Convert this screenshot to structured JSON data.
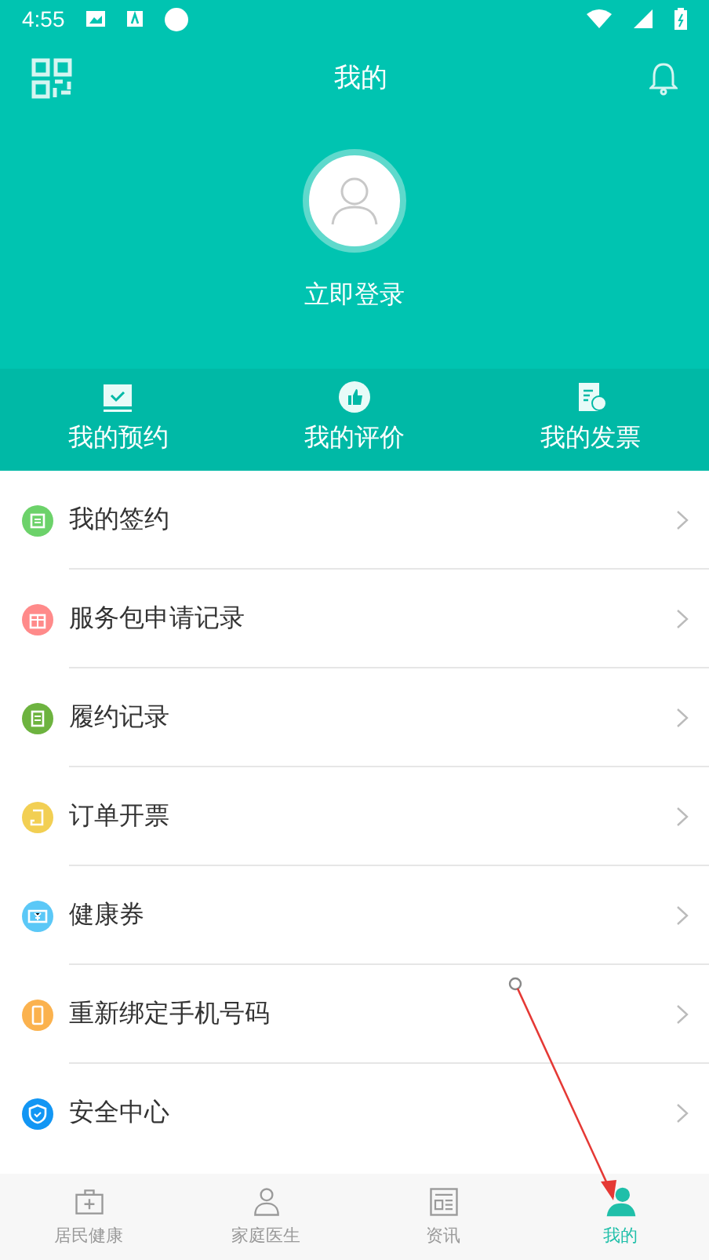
{
  "status_bar": {
    "time": "4:55"
  },
  "header": {
    "title": "我的"
  },
  "profile": {
    "login_label": "立即登录"
  },
  "shortcuts": [
    {
      "label": "我的预约"
    },
    {
      "label": "我的评价"
    },
    {
      "label": "我的发票"
    }
  ],
  "menu": [
    {
      "label": "我的签约",
      "color": "#6cd26a"
    },
    {
      "label": "服务包申请记录",
      "color": "#ff8a8a"
    },
    {
      "label": "履约记录",
      "color": "#6db33f"
    },
    {
      "label": "订单开票",
      "color": "#f2cf53"
    },
    {
      "label": "健康券",
      "color": "#5bc8f7"
    },
    {
      "label": "重新绑定手机号码",
      "color": "#fbb24e"
    },
    {
      "label": "安全中心",
      "color": "#1296f4"
    }
  ],
  "bottom_nav": [
    {
      "label": "居民健康",
      "selected": false
    },
    {
      "label": "家庭医生",
      "selected": false
    },
    {
      "label": "资讯",
      "selected": false
    },
    {
      "label": "我的",
      "selected": true
    }
  ]
}
